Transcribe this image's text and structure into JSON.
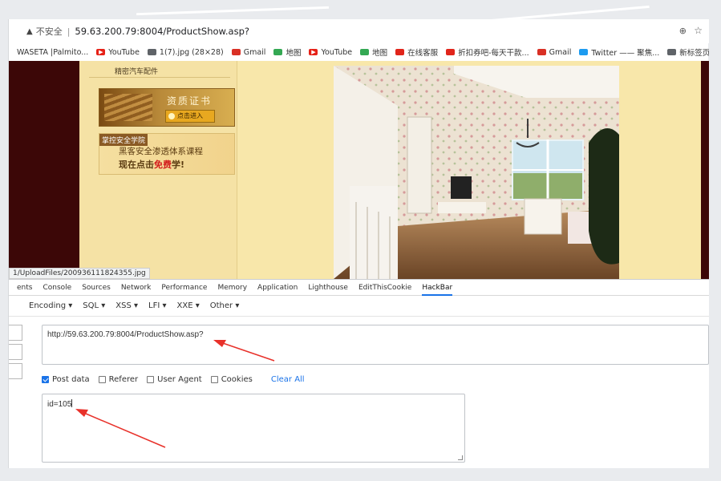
{
  "browser": {
    "insecure_label": "不安全",
    "separator": "|",
    "url": "59.63.200.79:8004/ProductShow.asp?",
    "zoom_icon": "magnifier-icon",
    "star_icon": "star-icon"
  },
  "bookmarks": [
    {
      "label": "WASETA |Palmito...",
      "icon": "none"
    },
    {
      "label": "YouTube",
      "icon": "youtube-icon",
      "color": "#e62117"
    },
    {
      "label": "1(7).jpg (28×28)",
      "icon": "globe-icon",
      "color": "#5f6368"
    },
    {
      "label": "Gmail",
      "icon": "gmail-icon",
      "color": "#d93025"
    },
    {
      "label": "地图",
      "icon": "maps-icon",
      "color": "#34a853"
    },
    {
      "label": "YouTube",
      "icon": "youtube-icon",
      "color": "#e62117"
    },
    {
      "label": "地图",
      "icon": "maps-icon",
      "color": "#34a853"
    },
    {
      "label": "在线客服",
      "icon": "jd-icon",
      "color": "#e1251b"
    },
    {
      "label": "折扣券吧-每天干款...",
      "icon": "coupon-icon",
      "color": "#e1251b"
    },
    {
      "label": "Gmail",
      "icon": "gmail-icon",
      "color": "#d93025"
    },
    {
      "label": "Twitter —— 聚焦...",
      "icon": "twitter-icon",
      "color": "#1d9bf0"
    },
    {
      "label": "新标签页",
      "icon": "globe-icon",
      "color": "#5f6368"
    }
  ],
  "page": {
    "sidebar_title": "精密汽车配件",
    "banner1_title": "资质证书",
    "banner1_button": "点击进入",
    "banner2_tag": "掌控安全学院",
    "banner2_line1": "黑客安全渗透体系课程",
    "banner2_line2_pre": "现在点击",
    "banner2_line2_red": "免费",
    "banner2_line2_post": "学!",
    "status_url": "1/UploadFiles/200936111824355.jpg"
  },
  "devtools": {
    "tabs": [
      "ents",
      "Console",
      "Sources",
      "Network",
      "Performance",
      "Memory",
      "Application",
      "Lighthouse",
      "EditThisCookie",
      "HackBar"
    ],
    "active_tab": "HackBar"
  },
  "hackbar": {
    "menu": [
      "Encoding ▾",
      "SQL ▾",
      "XSS ▾",
      "LFI ▾",
      "XXE ▾",
      "Other ▾"
    ],
    "url_value": "http://59.63.200.79:8004/ProductShow.asp?",
    "options": [
      {
        "label": "Post data",
        "checked": true
      },
      {
        "label": "Referer",
        "checked": false
      },
      {
        "label": "User Agent",
        "checked": false
      },
      {
        "label": "Cookies",
        "checked": false
      }
    ],
    "clear_all": "Clear All",
    "post_value": "id=105"
  },
  "colors": {
    "accent": "#1a73e8",
    "arrow": "#e8312a",
    "page_bg": "#f5e2a5",
    "page_dark": "#3c0707"
  }
}
